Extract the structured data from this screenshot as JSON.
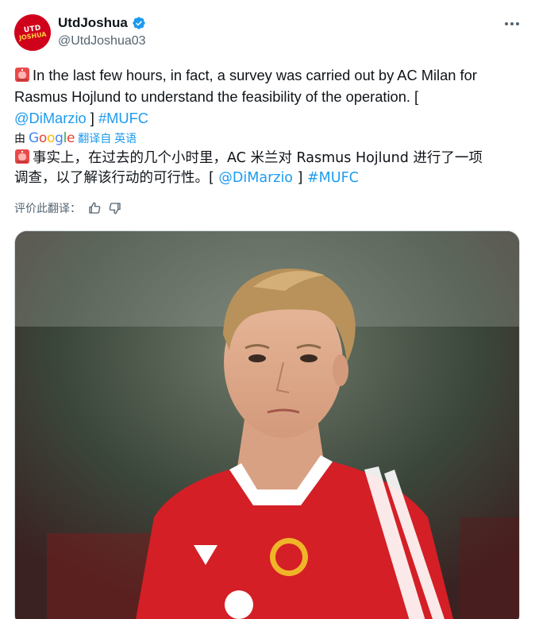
{
  "author": {
    "display_name": "UtdJoshua",
    "handle": "@UtdJoshua03",
    "avatar_text_top": "UTD",
    "avatar_text_bottom": "JOSHUA",
    "verified_icon": "verified-badge-icon"
  },
  "tweet": {
    "line1": "In the last few hours, in fact, a survey was carried out by AC Milan for",
    "line2": "Rasmus Hojlund to understand the feasibility of the operation. [",
    "mention": "@DiMarzio",
    "bracket_close": "]",
    "hashtag": "#MUFC"
  },
  "translation_bar": {
    "by": "由",
    "google": "Google",
    "translated_from": "翻译自 英语"
  },
  "translation": {
    "line1": "事实上，在过去的几个小时里，AC 米兰对 Rasmus Hojlund 进行了一项",
    "line2_prefix": "调查，以了解该行动的可行性。[",
    "mention": "@DiMarzio",
    "bracket_close": "]",
    "hashtag": "#MUFC"
  },
  "rate": {
    "label": "评价此翻译："
  },
  "media": {
    "description_icon": "photo"
  },
  "colors": {
    "link": "#1d9bf0",
    "secondary_text": "#536471",
    "verified": "#1d9bf0",
    "avatar_bg": "#d0021b"
  }
}
